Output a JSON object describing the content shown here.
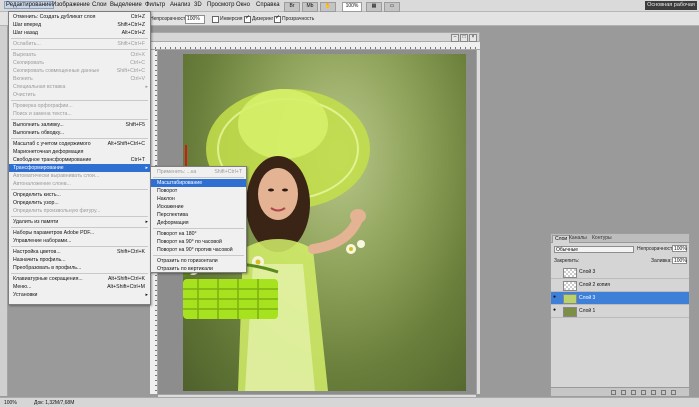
{
  "menubar": {
    "items": [
      "Редактирование",
      "Изображение",
      "Слои",
      "Выделение",
      "Фильтр",
      "Анализ",
      "3D",
      "Просмотр",
      "Окно",
      "Справка"
    ],
    "zoom": "100%",
    "workspace": "Основная рабочая"
  },
  "optionsbar": {
    "label_opacity": "Непрозрачность:",
    "opacity": "100%",
    "invert": "Инверсия",
    "dither": "Дизеринг",
    "transparency": "Прозрачность"
  },
  "edit_menu": {
    "items": [
      {
        "label": "Отменить: Создать дубликат слоя",
        "shortcut": "Ctrl+Z",
        "enabled": true
      },
      {
        "label": "Шаг вперед",
        "shortcut": "Shift+Ctrl+Z",
        "enabled": true
      },
      {
        "label": "Шаг назад",
        "shortcut": "Alt+Ctrl+Z",
        "enabled": true
      },
      {
        "label": "Ослабить...",
        "shortcut": "Shift+Ctrl+F",
        "enabled": false
      },
      {
        "label": "Вырезать",
        "shortcut": "Ctrl+X",
        "enabled": false
      },
      {
        "label": "Скопировать",
        "shortcut": "Ctrl+C",
        "enabled": false
      },
      {
        "label": "Скопировать совмещенные данные",
        "shortcut": "Shift+Ctrl+C",
        "enabled": false
      },
      {
        "label": "Вклеить",
        "shortcut": "Ctrl+V",
        "enabled": false
      },
      {
        "label": "Специальная вставка",
        "shortcut": "",
        "enabled": false
      },
      {
        "label": "Очистить",
        "shortcut": "",
        "enabled": false
      },
      {
        "label": "Проверка орфографии...",
        "shortcut": "",
        "enabled": false
      },
      {
        "label": "Поиск и замена текста...",
        "shortcut": "",
        "enabled": false
      },
      {
        "label": "Выполнить заливку...",
        "shortcut": "Shift+F5",
        "enabled": true
      },
      {
        "label": "Выполнить обводку...",
        "shortcut": "",
        "enabled": true
      },
      {
        "label": "Масштаб с учетом содержимого",
        "shortcut": "Alt+Shift+Ctrl+C",
        "enabled": true
      },
      {
        "label": "Марионеточная деформация",
        "shortcut": "",
        "enabled": true
      },
      {
        "label": "Свободное трансформирование",
        "shortcut": "Ctrl+T",
        "enabled": true
      },
      {
        "label": "Трансформирование",
        "shortcut": "",
        "enabled": true
      },
      {
        "label": "Автоматически выравнивать слои...",
        "shortcut": "",
        "enabled": false
      },
      {
        "label": "Автоналожение слоев...",
        "shortcut": "",
        "enabled": false
      },
      {
        "label": "Определить кисть...",
        "shortcut": "",
        "enabled": true
      },
      {
        "label": "Определить узор...",
        "shortcut": "",
        "enabled": true
      },
      {
        "label": "Определить произвольную фигуру...",
        "shortcut": "",
        "enabled": false
      },
      {
        "label": "Удалить из памяти",
        "shortcut": "",
        "enabled": true
      },
      {
        "label": "Наборы параметров Adobe PDF...",
        "shortcut": "",
        "enabled": true
      },
      {
        "label": "Управление наборами...",
        "shortcut": "",
        "enabled": true
      },
      {
        "label": "Настройка цветов...",
        "shortcut": "Shift+Ctrl+K",
        "enabled": true
      },
      {
        "label": "Назначить профиль...",
        "shortcut": "",
        "enabled": true
      },
      {
        "label": "Преобразовать в профиль...",
        "shortcut": "",
        "enabled": true
      },
      {
        "label": "Клавиатурные сокращения...",
        "shortcut": "Alt+Shift+Ctrl+K",
        "enabled": true
      },
      {
        "label": "Меню...",
        "shortcut": "Alt+Shift+Ctrl+M",
        "enabled": true
      },
      {
        "label": "Установки",
        "shortcut": "",
        "enabled": true
      }
    ]
  },
  "transform_submenu": {
    "items": [
      {
        "label": "Применить: ...ка",
        "shortcut": "Shift+Ctrl+T",
        "enabled": false
      },
      {
        "label": "Масштабирование",
        "shortcut": "",
        "enabled": true
      },
      {
        "label": "Поворот",
        "shortcut": "",
        "enabled": true
      },
      {
        "label": "Наклон",
        "shortcut": "",
        "enabled": true
      },
      {
        "label": "Искажение",
        "shortcut": "",
        "enabled": true
      },
      {
        "label": "Перспектива",
        "shortcut": "",
        "enabled": true
      },
      {
        "label": "Деформация",
        "shortcut": "",
        "enabled": true
      },
      {
        "label": "Поворот на 180°",
        "shortcut": "",
        "enabled": true
      },
      {
        "label": "Поворот на 90° по часовой",
        "shortcut": "",
        "enabled": true
      },
      {
        "label": "Поворот на 90° против часовой",
        "shortcut": "",
        "enabled": true
      },
      {
        "label": "Отразить по горизонтали",
        "shortcut": "",
        "enabled": true
      },
      {
        "label": "Отразить по вертикали",
        "shortcut": "",
        "enabled": true
      }
    ]
  },
  "layers_panel": {
    "tabs": [
      "Слои",
      "Каналы",
      "Контуры"
    ],
    "blend_mode": "Обычные",
    "opacity_label": "Непрозрачность:",
    "opacity": "100%",
    "lock_label": "Закрепить:",
    "fill_label": "Заливка:",
    "fill": "100%",
    "layers": [
      {
        "name": "Слой 3",
        "visible": false,
        "selected": false
      },
      {
        "name": "Слой 2 копия",
        "visible": false,
        "selected": false
      },
      {
        "name": "Слой 3",
        "visible": true,
        "selected": true
      },
      {
        "name": "Слой 1",
        "visible": true,
        "selected": false
      }
    ]
  },
  "statusbar": {
    "zoom": "100%",
    "doc_info": "Док: 1,32М/7,68М"
  }
}
